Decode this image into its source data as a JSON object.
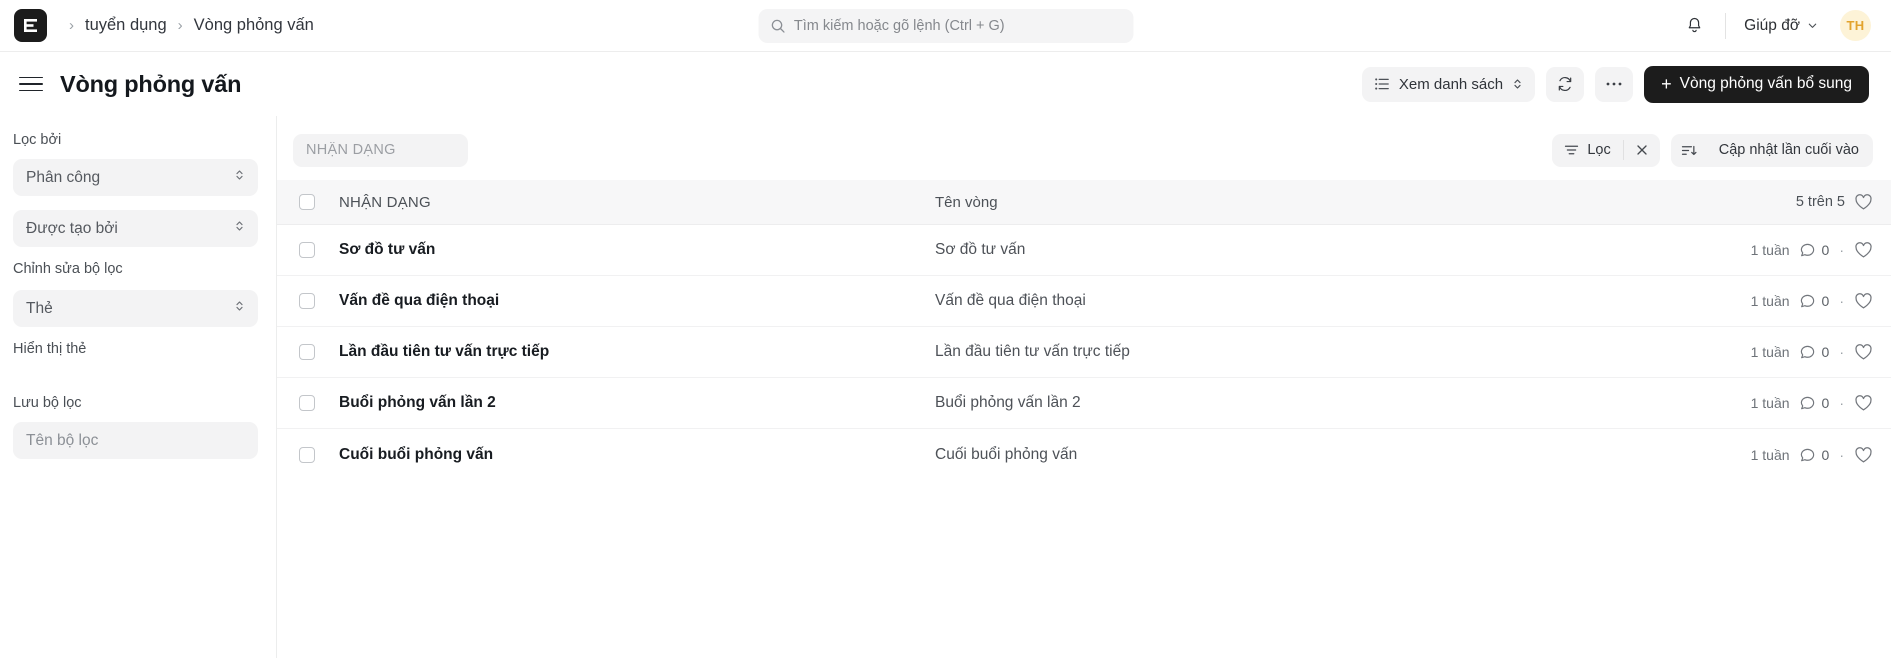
{
  "navbar": {
    "logo_letter": "E",
    "breadcrumbs": [
      {
        "label": "tuyển dụng"
      },
      {
        "label": "Vòng phỏng vấn"
      }
    ],
    "separator": "›",
    "search": {
      "placeholder": "Tìm kiếm hoặc gõ lệnh (Ctrl + G)",
      "value": ""
    },
    "help_label": "Giúp đỡ",
    "avatar_initials": "TH",
    "avatar_bg": "#fdf3d7",
    "avatar_color": "#e2a32d"
  },
  "page_header": {
    "title": "Vòng phỏng vấn",
    "view_selector_label": "Xem danh sách",
    "refresh_label": "",
    "more_label": "···",
    "primary_button_label": "Vòng phỏng vấn bổ sung",
    "primary_button_plus": "+",
    "primary_button_bg": "#1c1c1c"
  },
  "sidebar": {
    "filter_by_label": "Lọc bởi",
    "assigned_select": "Phân công",
    "created_by_select": "Được tạo bởi",
    "edit_filters_label": "Chỉnh sửa bộ lọc",
    "tags_select": "Thẻ",
    "show_tags_label": "Hiển thị thẻ",
    "save_filter_label": "Lưu bộ lọc",
    "filter_name_placeholder": "Tên bộ lọc",
    "filter_name_value": ""
  },
  "toolbar": {
    "id_placeholder": "NHẬN DẠNG",
    "id_value": "",
    "filter_label": "Lọc",
    "clear_label": "×",
    "sort_label": "Cập nhật lần cuối vào"
  },
  "table": {
    "header": {
      "id_column": "NHẬN DẠNG",
      "name_column": "Tên vòng",
      "count_label": "5 trên 5"
    },
    "rows": [
      {
        "id": "Sơ đồ tư vấn",
        "name": "Sơ đồ tư vấn",
        "time": "1 tuần",
        "comments": "0"
      },
      {
        "id": "Vấn đề qua điện thoại",
        "name": "Vấn đề qua điện thoại",
        "time": "1 tuần",
        "comments": "0"
      },
      {
        "id": "Lần đầu tiên tư vấn trực tiếp",
        "name": "Lần đầu tiên tư vấn trực tiếp",
        "time": "1 tuần",
        "comments": "0"
      },
      {
        "id": "Buổi phỏng vấn lần 2",
        "name": "Buổi phỏng vấn lần 2",
        "time": "1 tuần",
        "comments": "0"
      },
      {
        "id": "Cuối buổi phỏng vấn",
        "name": "Cuối buổi phỏng vấn",
        "time": "1 tuần",
        "comments": "0"
      }
    ],
    "separator_dot": "·"
  }
}
